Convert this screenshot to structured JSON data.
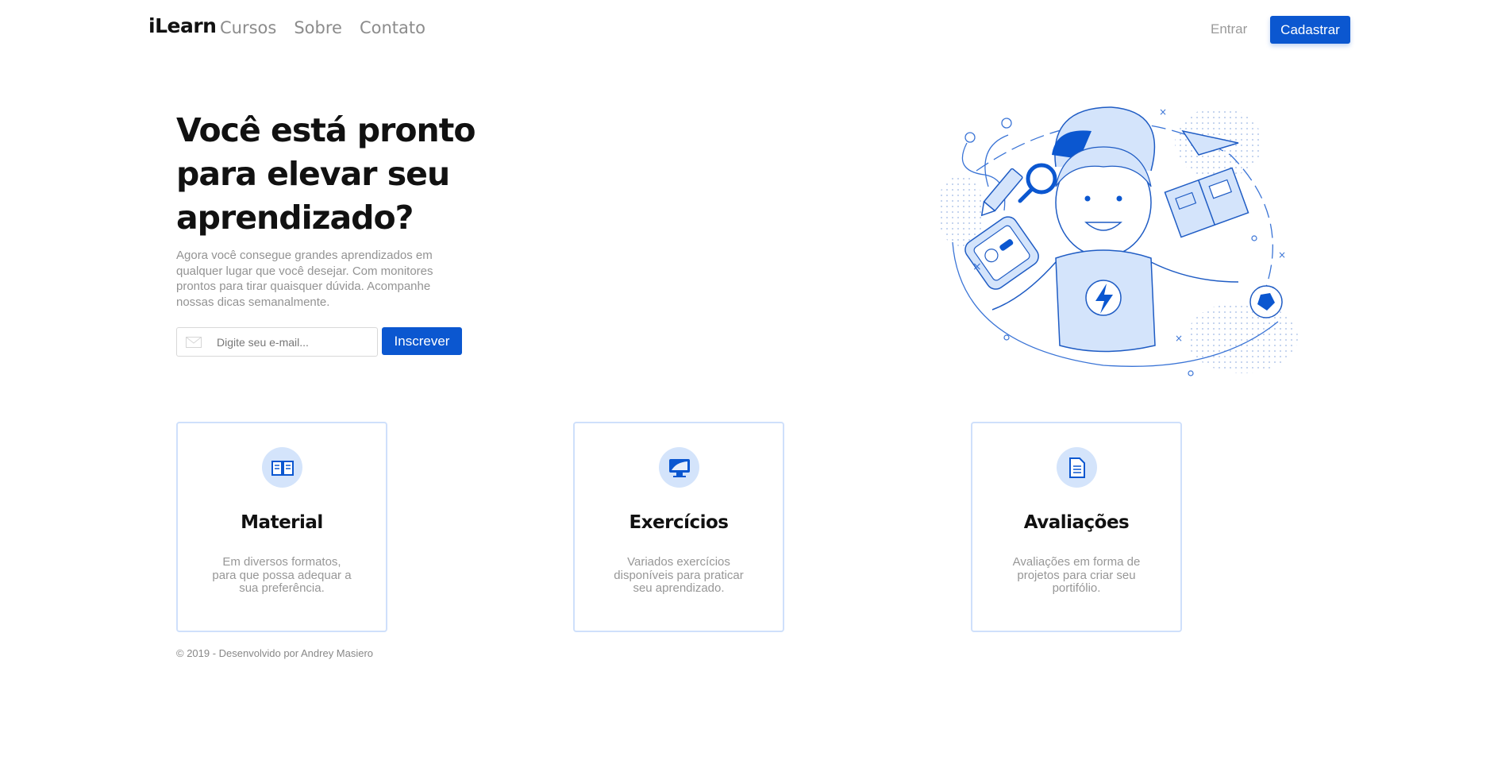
{
  "nav": {
    "brand": "iLearn",
    "links": [
      "Cursos",
      "Sobre",
      "Contato"
    ],
    "login": "Entrar",
    "signup": "Cadastrar"
  },
  "hero": {
    "title": "Você está pronto para elevar seu aprendizado?",
    "text": "Agora você consegue grandes aprendizados em qualquer lugar que você desejar. Com monitores prontos para tirar quaisquer dúvida. Acompanhe nossas dicas semanalmente.",
    "email_placeholder": "Digite seu e-mail...",
    "subscribe": "Inscrever"
  },
  "cards": [
    {
      "icon": "book-icon",
      "title": "Material",
      "text": "Em diversos formatos, para que possa adequar a sua preferência."
    },
    {
      "icon": "monitor-icon",
      "title": "Exercícios",
      "text": "Variados exercícios disponíveis para praticar seu aprendizado."
    },
    {
      "icon": "document-icon",
      "title": "Avaliações",
      "text": "Avaliações em forma de projetos para criar seu portifólio."
    }
  ],
  "footer": "© 2019 - Desenvolvido por Andrey Masiero",
  "colors": {
    "accent": "#0b57d0",
    "accent_light": "#d4e4fb",
    "card_border": "#cfe0fb"
  }
}
